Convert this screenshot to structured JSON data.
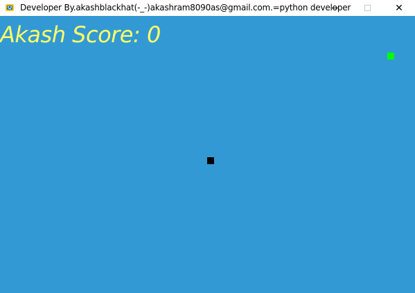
{
  "window": {
    "title": "Developer By.akashblackhat(-_-)akashram8090as@gmail.com.=python developer",
    "icon": "pygame-snake-icon"
  },
  "controls": {
    "minimize": "minimize-icon",
    "maximize": "maximize-icon",
    "close_glyph": "✕"
  },
  "game": {
    "score_label": "Akash Score: 0",
    "score_value": 0,
    "background_color": "#3399d4",
    "score_color": "#ffff66",
    "food_color": "#00ff00",
    "snake_color": "#000000"
  }
}
